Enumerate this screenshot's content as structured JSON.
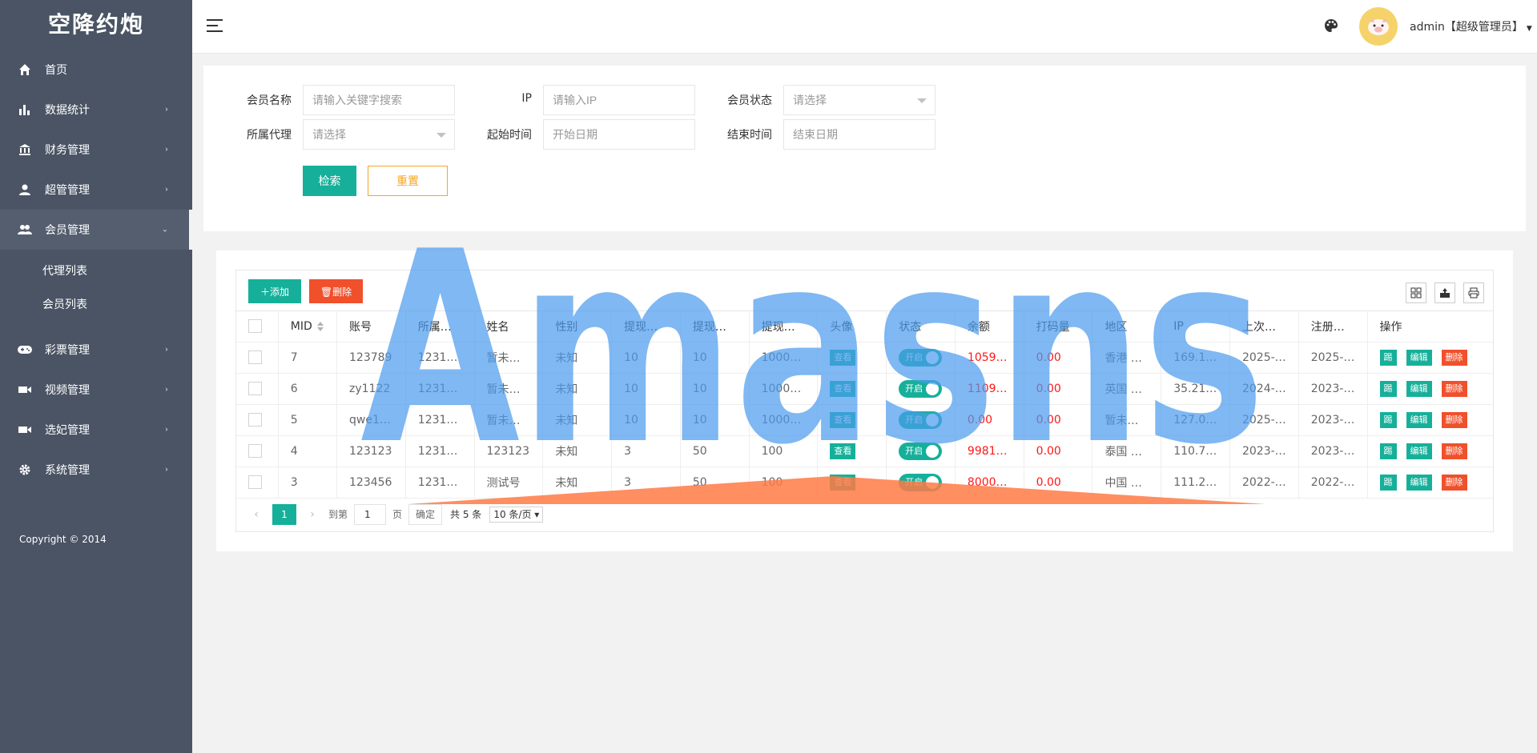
{
  "app": {
    "brand": "空降约炮",
    "copyright": "Copyright © 2014"
  },
  "sidebar": {
    "items": [
      {
        "label": "首页",
        "icon": "home-icon"
      },
      {
        "label": "数据统计",
        "icon": "bar-chart-icon"
      },
      {
        "label": "财务管理",
        "icon": "bank-icon"
      },
      {
        "label": "超管管理",
        "icon": "user-icon"
      },
      {
        "label": "会员管理",
        "icon": "users-icon"
      },
      {
        "label": "彩票管理",
        "icon": "gamepad-icon"
      },
      {
        "label": "视频管理",
        "icon": "video-icon"
      },
      {
        "label": "选妃管理",
        "icon": "video-icon"
      },
      {
        "label": "系统管理",
        "icon": "gear-icon"
      }
    ],
    "submenu": [
      "代理列表",
      "会员列表"
    ]
  },
  "header": {
    "user": "admin【超级管理员】"
  },
  "search": {
    "member_name_label": "会员名称",
    "member_name_placeholder": "请输入关键字搜索",
    "ip_label": "IP",
    "ip_placeholder": "请输入IP",
    "status_label": "会员状态",
    "status_placeholder": "请选择",
    "agent_label": "所属代理",
    "agent_placeholder": "请选择",
    "start_label": "起始时间",
    "start_placeholder": "开始日期",
    "end_label": "结束时间",
    "end_placeholder": "结束日期",
    "search_btn": "检索",
    "reset_btn": "重置"
  },
  "table": {
    "add_btn": "添加",
    "delete_btn": "删除",
    "columns": [
      "MID",
      "账号",
      "所属…",
      "姓名",
      "性别",
      "提现…",
      "提现…",
      "提现…",
      "头像",
      "状态",
      "余额",
      "打码量",
      "地区",
      "IP",
      "上次…",
      "注册…",
      "操作"
    ],
    "view_label": "查看",
    "switch_label": "开启",
    "op_kick": "踢",
    "op_edit": "编辑",
    "op_delete": "删除",
    "rows": [
      [
        "7",
        "123789",
        "1231…",
        "暂未…",
        "未知",
        "10",
        "10",
        "1000…",
        "1059…",
        "0.00",
        "香港 …",
        "169.1…",
        "2025-…",
        "2025-…"
      ],
      [
        "6",
        "zy1122",
        "1231…",
        "暂未…",
        "未知",
        "10",
        "10",
        "1000…",
        "1109…",
        "0.00",
        "英国 …",
        "35.21…",
        "2024-…",
        "2023-…"
      ],
      [
        "5",
        "qwe1…",
        "1231…",
        "暂未…",
        "未知",
        "10",
        "10",
        "1000…",
        "0.00",
        "0.00",
        "暂未…",
        "127.0…",
        "2025-…",
        "2023-…"
      ],
      [
        "4",
        "123123",
        "1231…",
        "123123",
        "未知",
        "3",
        "50",
        "100",
        "9981…",
        "0.00",
        "泰国 …",
        "110.7…",
        "2023-…",
        "2023-…"
      ],
      [
        "3",
        "123456",
        "1231…",
        "测试号",
        "未知",
        "3",
        "50",
        "100",
        "8000…",
        "0.00",
        "中国 …",
        "111.2…",
        "2022-…",
        "2022-…"
      ]
    ]
  },
  "pager": {
    "current": "1",
    "goto": "到第",
    "page_input": "1",
    "page_unit": "页",
    "ok": "确定",
    "total": "共 5 条",
    "size": "10 条/页"
  },
  "watermark": {
    "text": "Amasns",
    "color": "#4a9bef",
    "accent": "#ff7a45"
  }
}
